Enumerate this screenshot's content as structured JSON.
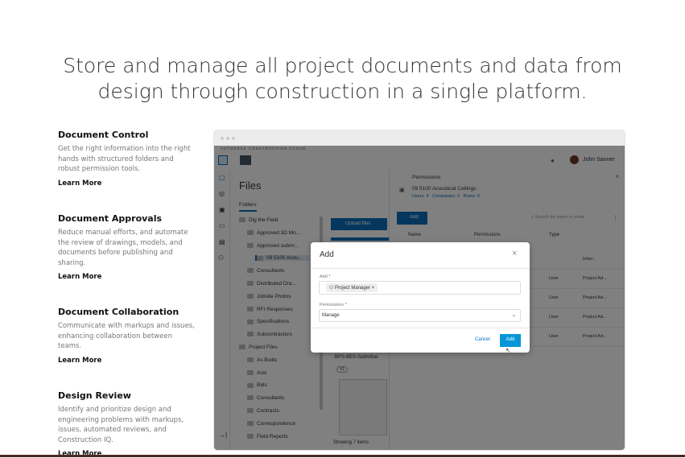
{
  "hero": {
    "line1": "Store and manage all project documents and data from",
    "line2": "design through construction in a single platform."
  },
  "features": [
    {
      "title": "Document Control",
      "desc": "Get the right information into the right hands with structured folders and robust permission tools.",
      "link": "Learn More"
    },
    {
      "title": "Document Approvals",
      "desc": "Reduce manual efforts, and automate the review of drawings, models, and documents before publishing and sharing.",
      "link": "Learn More"
    },
    {
      "title": "Document Collaboration",
      "desc": "Communicate with markups and issues, enhancing collaboration between teams.",
      "link": "Learn More"
    },
    {
      "title": "Design Review",
      "desc": "Identify and prioritize design and engineering problems with markups, issues, automated reviews, and Construction IQ.",
      "link": "Learn More"
    }
  ],
  "app": {
    "brand": "AUTODESK CONSTRUCTION CLOUD",
    "user": "John Sanner",
    "files_title": "Files",
    "folders_tab": "Folders",
    "tree": [
      "Dig the Field",
      "Approved 3D Mo...",
      "Approved submi...",
      "09 5100 Acou...",
      "Consultants",
      "Distributed Dra...",
      "Jobsite Photos",
      "RFI Responses",
      "Specifications",
      "Subcontractors",
      "Project Files",
      "As Builts",
      "Asis",
      "Bids",
      "Consultants",
      "Contracts",
      "Correspondence",
      "Field Reports"
    ],
    "upload": "Upload files",
    "file_name": "BPS-BES-Submittal-",
    "version": "V1",
    "showing": "Showing 7 items",
    "permissions": {
      "title": "Permissions",
      "folder": "09 5100 Acoustical Ceilings",
      "users": "Users: 4",
      "companies": "Companies: 0",
      "roles": "Roles: 0",
      "add": "Add",
      "search_placeholder": "Search for name or email",
      "cols": [
        "Name",
        "Permissions",
        "Type"
      ],
      "rows": [
        {
          "type": "",
          "perm": "Inher..."
        },
        {
          "type": "User",
          "perm": "Project Ad..."
        },
        {
          "type": "User",
          "perm": "Project Ad..."
        },
        {
          "type": "User",
          "perm": "Project Ad..."
        },
        {
          "type": "User",
          "perm": "Project Ad..."
        }
      ]
    }
  },
  "modal": {
    "title": "Add",
    "add_label": "Add *",
    "chip": "Project Manager",
    "perm_label": "Permissions *",
    "perm_value": "Manage",
    "cancel": "Cancel",
    "submit": "Add"
  }
}
